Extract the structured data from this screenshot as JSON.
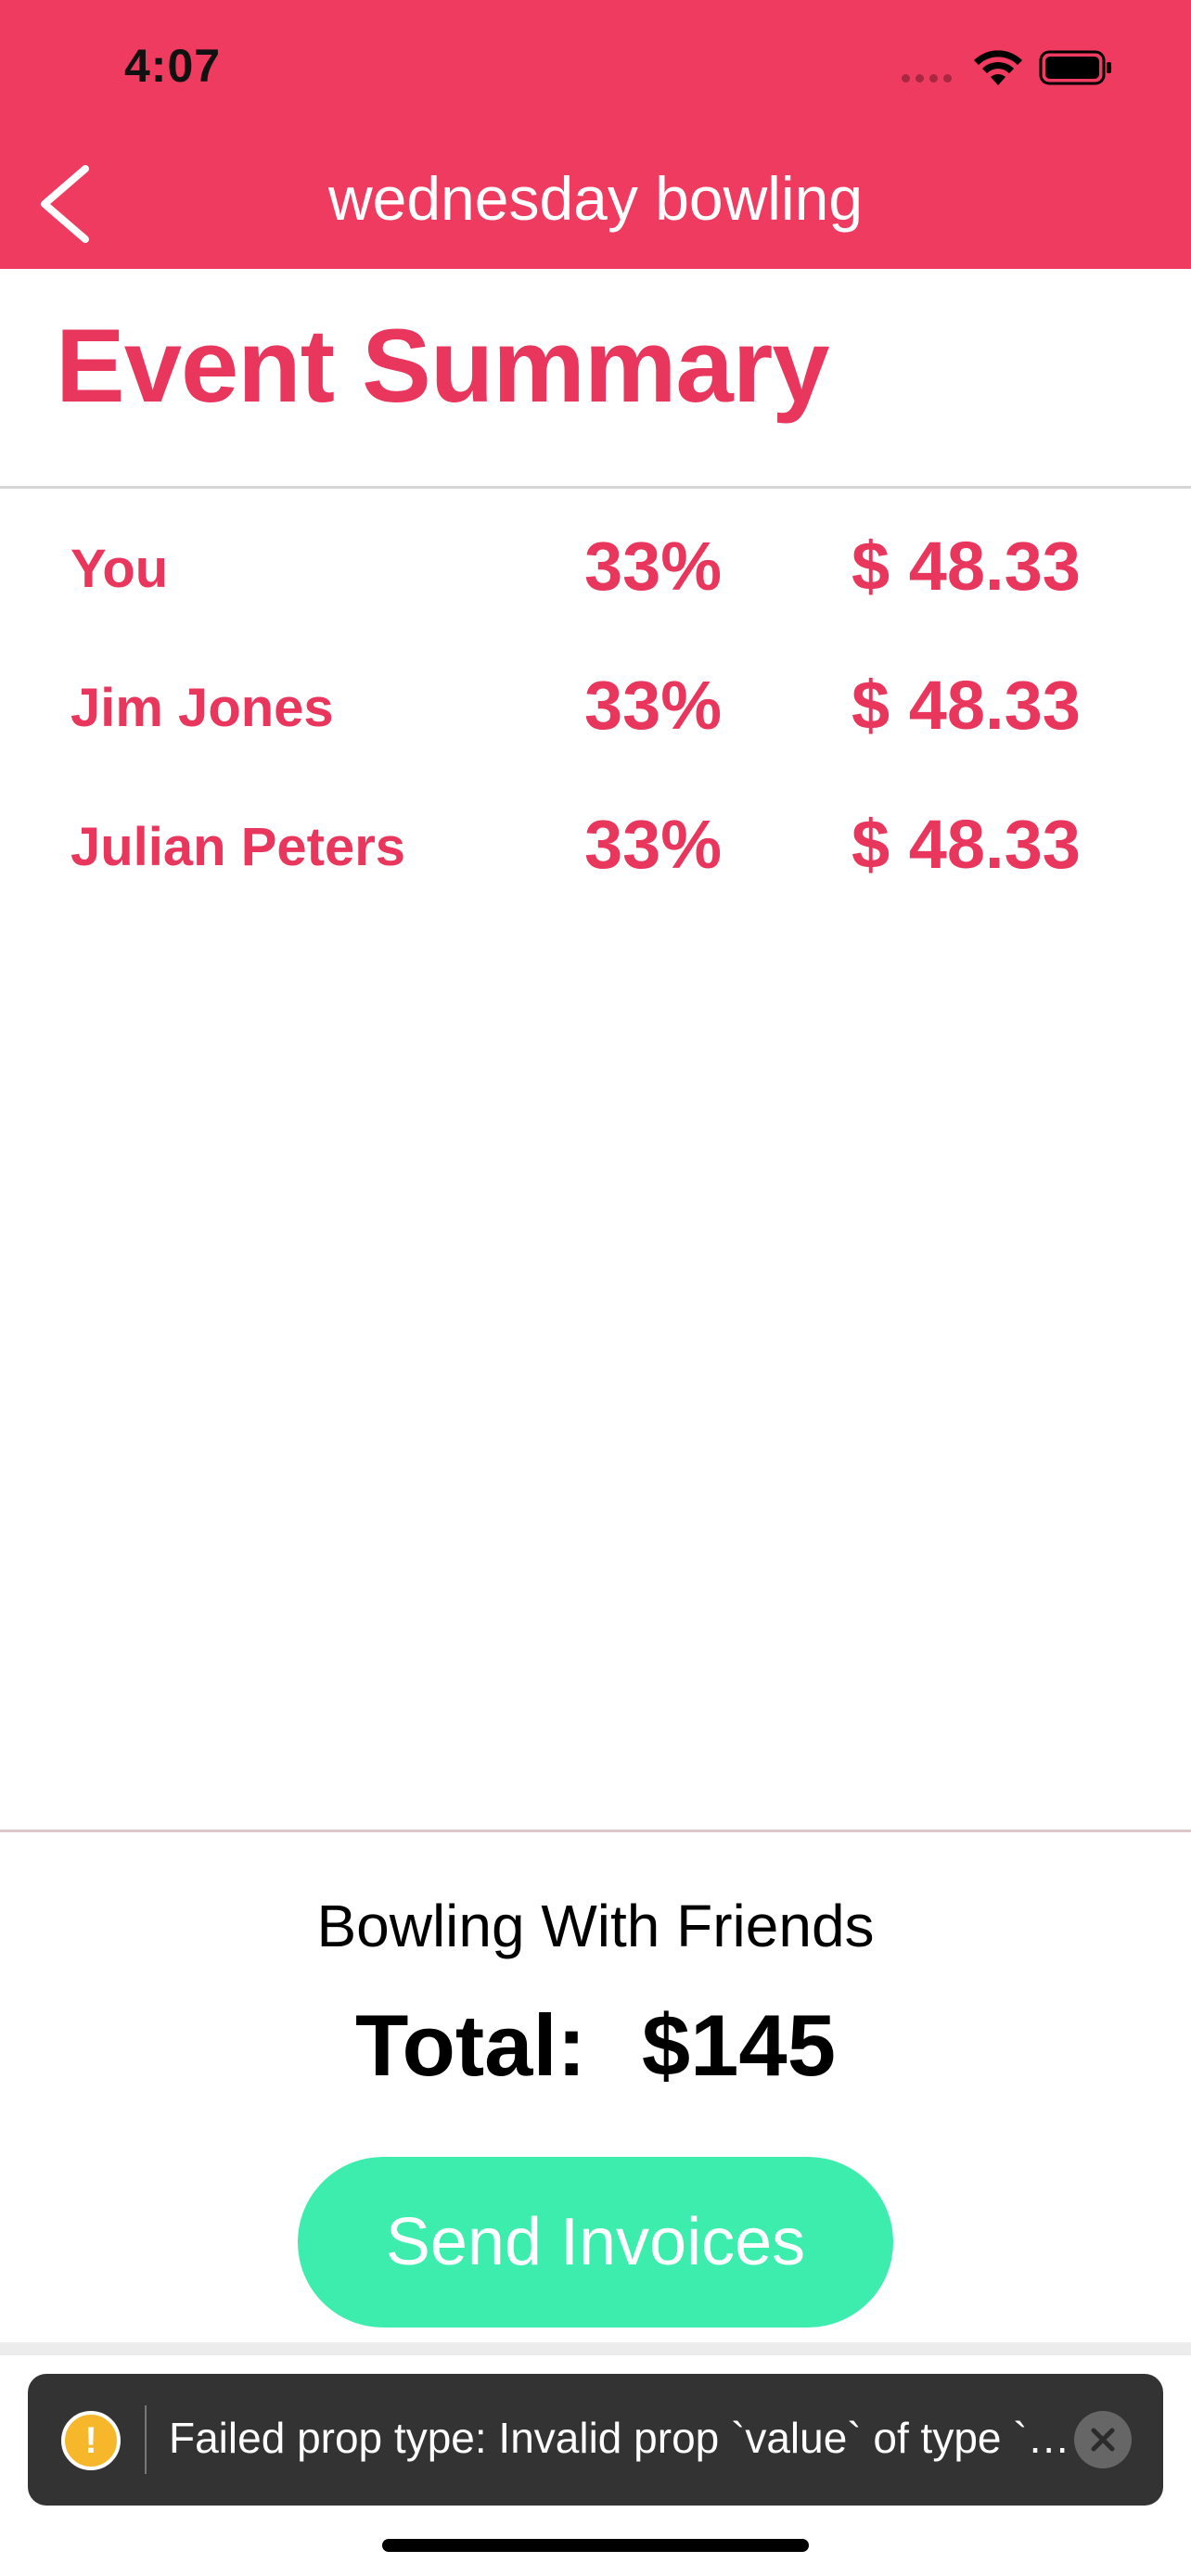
{
  "status_bar": {
    "time": "4:07"
  },
  "nav": {
    "title": "wednesday bowling"
  },
  "page": {
    "title": "Event Summary"
  },
  "participants": [
    {
      "name": "You",
      "percent": "33%",
      "amount": "$ 48.33"
    },
    {
      "name": "Jim Jones",
      "percent": "33%",
      "amount": "$ 48.33"
    },
    {
      "name": "Julian Peters",
      "percent": "33%",
      "amount": "$ 48.33"
    }
  ],
  "summary": {
    "event_name": "Bowling With Friends",
    "total_label": "Total:",
    "total_amount": "$145"
  },
  "actions": {
    "send_label": "Send Invoices"
  },
  "toast": {
    "message": "Failed prop type: Invalid prop `value` of type `n..."
  },
  "colors": {
    "header": "#EF3B5F",
    "accent_text": "#E8365C",
    "button": "#3CEDAE",
    "toast_bg": "#333333",
    "warning": "#F7B72A"
  },
  "icons": {
    "back": "chevron-left-icon",
    "wifi": "wifi-icon",
    "battery": "battery-icon",
    "warning": "warning-icon",
    "close": "close-icon"
  }
}
